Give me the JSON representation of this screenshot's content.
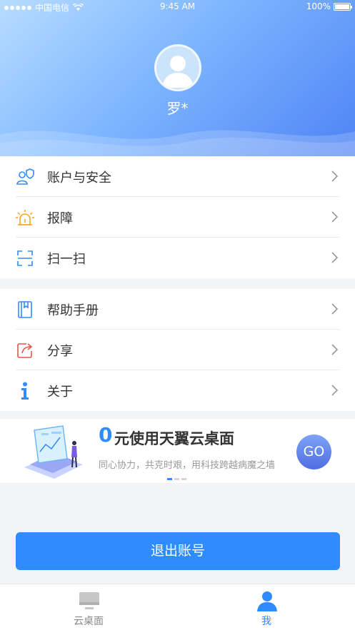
{
  "status_bar": {
    "carrier": "中国电信",
    "time": "9:45 AM",
    "battery": "100%"
  },
  "profile": {
    "username": "罗*"
  },
  "menu_group_1": [
    {
      "label": "账户与安全",
      "icon": "account-security-icon"
    },
    {
      "label": "报障",
      "icon": "alarm-icon"
    },
    {
      "label": "扫一扫",
      "icon": "scan-icon"
    }
  ],
  "menu_group_2": [
    {
      "label": "帮助手册",
      "icon": "manual-icon"
    },
    {
      "label": "分享",
      "icon": "share-icon"
    },
    {
      "label": "关于",
      "icon": "info-icon"
    }
  ],
  "promo": {
    "zero": "0",
    "title": "元使用天翼云桌面",
    "subtitle": "同心协力，共克时艰，用科技跨越病魔之墙",
    "go_label": "GO"
  },
  "logout": {
    "label": "退出账号"
  },
  "tabbar": {
    "tabs": [
      {
        "label": "云桌面",
        "icon": "desktop-icon",
        "active": false
      },
      {
        "label": "我",
        "icon": "person-icon",
        "active": true
      }
    ]
  },
  "colors": {
    "accent": "#2f8cff",
    "alarm": "#f5a623",
    "share": "#e8534a"
  }
}
